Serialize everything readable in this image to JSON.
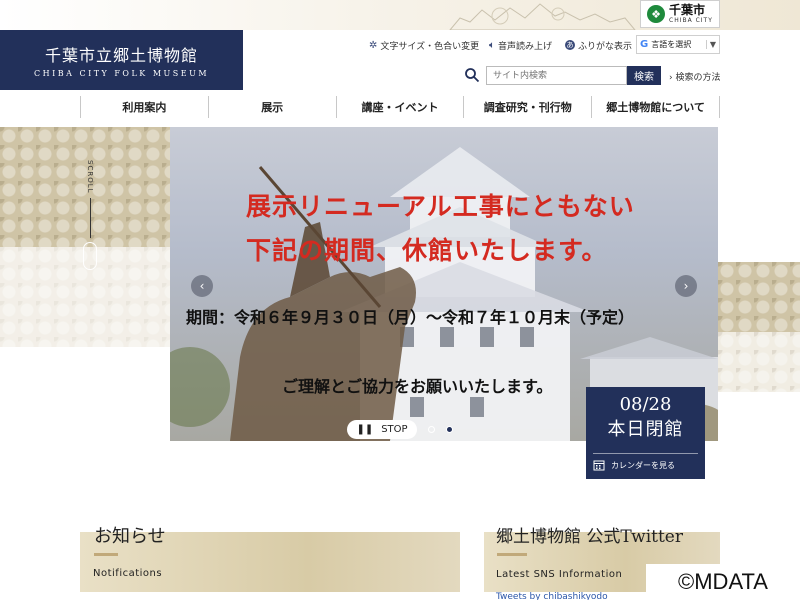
{
  "header": {
    "site_name_jp": "千葉市立郷土博物館",
    "site_name_en": "CHIBA CITY FOLK MUSEUM",
    "chiba_logo_jp": "千葉市",
    "chiba_logo_en": "CHIBA CITY",
    "utilities": {
      "text_size": "文字サイズ・色合い変更",
      "read_aloud": "音声読み上げ",
      "furigana": "ふりがな表示"
    },
    "translate_label": "言語を選択",
    "search": {
      "placeholder": "サイト内検索",
      "button": "検索",
      "help": "検索の方法"
    }
  },
  "nav": {
    "items": [
      "利用案内",
      "展示",
      "講座・イベント",
      "調査研究・刊行物",
      "郷土博物館について"
    ]
  },
  "scroll_label": "SCROLL",
  "slide": {
    "heading_line1": "展示リニューアル工事にともない",
    "heading_line2": "下記の期間、休館いたします。",
    "period": "期間：令和６年９月３０日（月）〜令和７年１０月末（予定）",
    "thanks": "ご理解とご協力をお願いいたします。",
    "stop_label": "STOP"
  },
  "closed_notice": {
    "date": "08/28",
    "status": "本日閉館",
    "calendar_link": "カレンダーを見る"
  },
  "sections": {
    "news_title": "お知らせ",
    "news_subtitle": "Notifications",
    "twitter_title": "郷土博物館 公式Twitter",
    "twitter_subtitle": "Latest SNS Information",
    "tweet_link": "Tweets by chibashikyodo"
  },
  "watermark": "©MDATA",
  "colors": {
    "navy": "#22305a",
    "accent_red": "#d42a20",
    "gold": "#c1a97a"
  }
}
